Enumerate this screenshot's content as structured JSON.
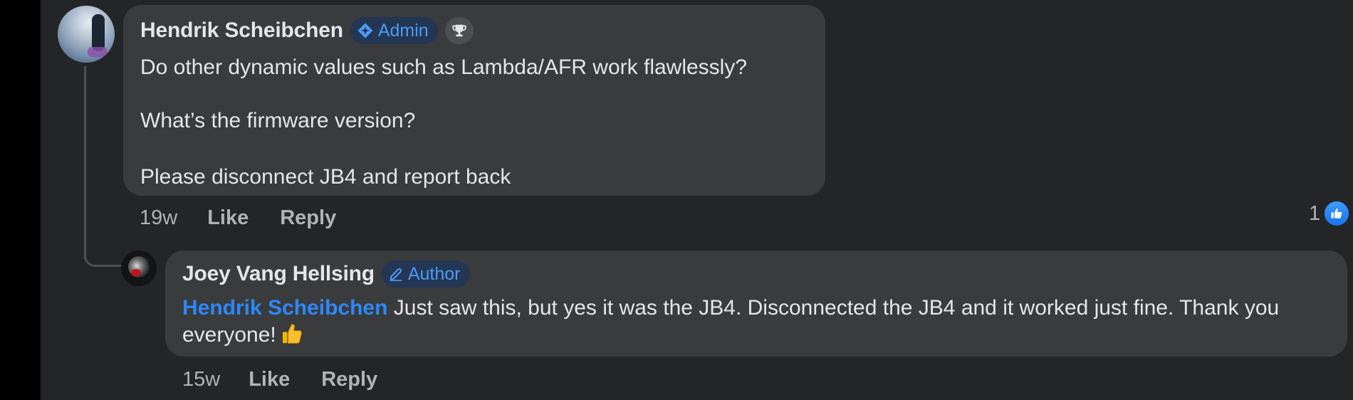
{
  "comment": {
    "author": "Hendrik Scheibchen",
    "badge_label": "Admin",
    "badge_icon": "admin-shield-icon",
    "extra_badge_icon": "trophy-icon",
    "lines": [
      "Do other dynamic values such as Lambda/AFR work flawlessly?",
      "What’s the firmware version?",
      "Please disconnect JB4 and report back"
    ],
    "timestamp": "19w",
    "like_label": "Like",
    "reply_label": "Reply",
    "reaction_count": "1",
    "reaction_icon": "like-reaction-icon",
    "colors": {
      "bubble": "#3a3b3c",
      "badge_bg": "#233653",
      "badge_text": "#4c9bf5",
      "like_blue": "#1877f2"
    }
  },
  "reply": {
    "author": "Joey Vang Hellsing",
    "badge_label": "Author",
    "badge_icon": "pencil-icon",
    "mention": "Hendrik Scheibchen",
    "text": "Just saw this, but yes it was the JB4. Disconnected the JB4 and it worked just fine. Thank you everyone!",
    "emoji": "thumbs-up-emoji",
    "timestamp": "15w",
    "like_label": "Like",
    "reply_label": "Reply"
  }
}
